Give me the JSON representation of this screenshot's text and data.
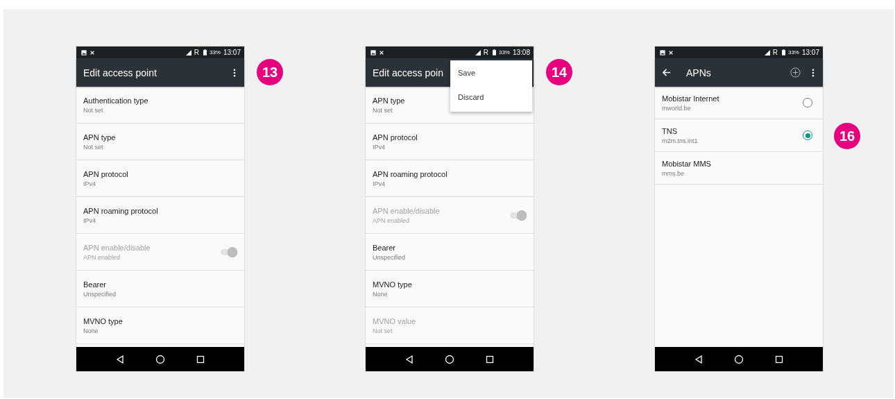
{
  "screens": [
    {
      "status_bar": {
        "roaming": "R",
        "battery": "33%",
        "time": "13:07"
      },
      "app_bar": {
        "back": false,
        "title": "Edit access point",
        "add": false,
        "more": true,
        "badge": "13"
      },
      "kind": "settings",
      "rows": [
        {
          "kind": "text",
          "title": "Authentication type",
          "value": "Not set",
          "disabled": false
        },
        {
          "kind": "text",
          "title": "APN type",
          "value": "Not set",
          "disabled": false
        },
        {
          "kind": "text",
          "title": "APN protocol",
          "value": "IPv4",
          "disabled": false
        },
        {
          "kind": "text",
          "title": "APN roaming protocol",
          "value": "IPv4",
          "disabled": false
        },
        {
          "kind": "switch",
          "title": "APN enable/disable",
          "value": "APN enabled",
          "disabled": true,
          "on": true
        },
        {
          "kind": "text",
          "title": "Bearer",
          "value": "Unspecified",
          "disabled": false
        },
        {
          "kind": "text",
          "title": "MVNO type",
          "value": "None",
          "disabled": false
        }
      ]
    },
    {
      "status_bar": {
        "roaming": "R",
        "battery": "33%",
        "time": "13:08"
      },
      "app_bar": {
        "back": false,
        "title": "Edit access poin",
        "add": false,
        "more": false,
        "badge": "14"
      },
      "kind": "settings",
      "menu": [
        "Save",
        "Discard"
      ],
      "rows": [
        {
          "kind": "text",
          "title": "APN type",
          "value": "Not set",
          "disabled": false
        },
        {
          "kind": "text",
          "title": "APN protocol",
          "value": "IPv4",
          "disabled": false
        },
        {
          "kind": "text",
          "title": "APN roaming protocol",
          "value": "IPv4",
          "disabled": false
        },
        {
          "kind": "switch",
          "title": "APN enable/disable",
          "value": "APN enabled",
          "disabled": true,
          "on": true
        },
        {
          "kind": "text",
          "title": "Bearer",
          "value": "Unspecified",
          "disabled": false
        },
        {
          "kind": "text",
          "title": "MVNO type",
          "value": "None",
          "disabled": false
        },
        {
          "kind": "text",
          "title": "MVNO value",
          "value": "Not set",
          "disabled": true
        }
      ]
    },
    {
      "status_bar": {
        "roaming": "R",
        "battery": "33%",
        "time": "13:07"
      },
      "app_bar": {
        "back": true,
        "title": "APNs",
        "add": true,
        "more": true
      },
      "kind": "apn_list",
      "rows": [
        {
          "title": "Mobistar Internet",
          "value": "mworld.be",
          "selected": false,
          "kind": "radio"
        },
        {
          "title": "TNS",
          "value": "m2m.tns.int1",
          "selected": true,
          "kind": "radio",
          "badge": "16"
        },
        {
          "title": "Mobistar MMS",
          "value": "mms.be",
          "kind": "plain"
        }
      ]
    }
  ]
}
